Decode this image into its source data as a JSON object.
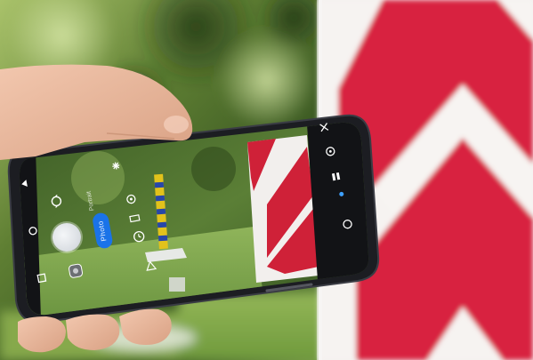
{
  "scene": {
    "description_colors": {
      "foliage_dark": "#2f4a1f",
      "foliage_light": "#8fb25a",
      "sign_red": "#d8213f",
      "sign_white": "#f6f3f1",
      "phone_body": "#1c1d22",
      "skin": "#e9b9a0",
      "post_yellow": "#e2c21b",
      "post_blue": "#2747a8"
    }
  },
  "camera_app": {
    "accent_color": "#1a73e8",
    "controls": {
      "shutter": {
        "icon": "shutter-button"
      },
      "mode_switch": {
        "label": "Photo"
      },
      "mode_other": {
        "label": "Portrait"
      },
      "switch_camera": {
        "icon": "switch-camera-icon"
      },
      "gallery": {
        "icon": "gallery-thumbnail-icon"
      },
      "lens": {
        "icon": "lens-icon"
      },
      "timer": {
        "icon": "timer-icon"
      },
      "flash": {
        "icon": "flash-icon"
      },
      "settings": {
        "icon": "settings-icon"
      },
      "motion": {
        "icon": "motion-icon"
      },
      "ratio": {
        "icon": "ratio-icon"
      },
      "nav_back": {
        "icon": "nav-back-icon"
      },
      "nav_home": {
        "icon": "nav-home-icon"
      },
      "nav_recents": {
        "icon": "nav-recents-icon"
      }
    }
  }
}
